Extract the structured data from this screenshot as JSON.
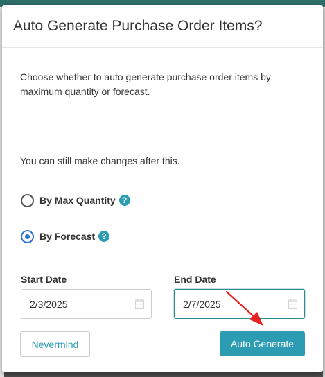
{
  "modal": {
    "title": "Auto Generate Purchase Order Items?",
    "description": "Choose whether to auto generate purchase order items by maximum quantity or forecast.",
    "note": "You can still make changes after this.",
    "options": [
      {
        "label": "By Max Quantity",
        "selected": false
      },
      {
        "label": "By Forecast",
        "selected": true
      }
    ],
    "help_glyph": "?",
    "start_date": {
      "label": "Start Date",
      "value": "2/3/2025"
    },
    "end_date": {
      "label": "End Date",
      "value": "2/7/2025"
    },
    "buttons": {
      "cancel": "Nevermind",
      "confirm": "Auto Generate"
    }
  },
  "colors": {
    "accent": "#2b9cb2",
    "radio_selected": "#2a74d0",
    "annotation_arrow": "#e8231f"
  },
  "icons": [
    "help-icon",
    "calendar-icon",
    "annotation-arrow"
  ]
}
